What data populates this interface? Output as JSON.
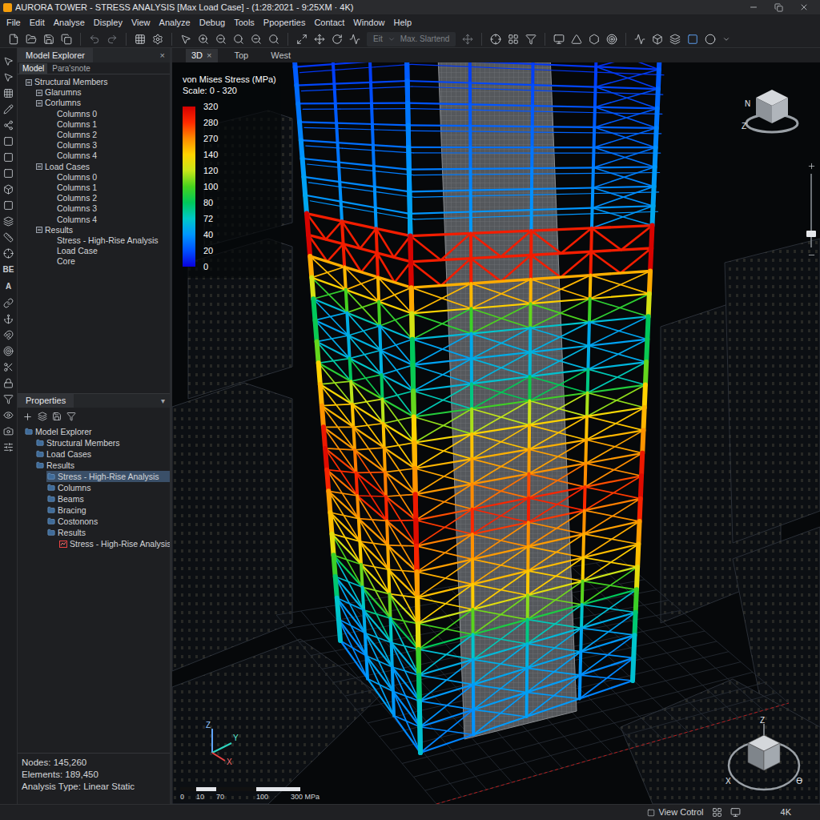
{
  "window": {
    "title": "AURORA TOWER - STRESS ANALYSIS [Max Load Case] - (1:28:2021 - 9:25XM · 4K)"
  },
  "menu": [
    "File",
    "Edit",
    "Analyse",
    "Displey",
    "View",
    "Analyze",
    "Debug",
    "Tools",
    "Ppoperties",
    "Contact",
    "Window",
    "Help"
  ],
  "toolbar": {
    "fields": [
      {
        "label": "Eit",
        "disabled": true
      },
      {
        "label": "Max. Slartend",
        "disabled": true
      }
    ]
  },
  "tool_strip": {
    "glyphs": [
      "BE",
      "A"
    ]
  },
  "model_explorer": {
    "title": "Model Explorer",
    "close": "×",
    "tabs": [
      {
        "label": "Model",
        "selected": true
      },
      {
        "label": "Para'snote",
        "selected": false
      }
    ],
    "tree": [
      {
        "label": "Structural Members",
        "depth": 0,
        "kind": "folder",
        "expanded": true,
        "selected": false
      },
      {
        "label": "Glarumns",
        "depth": 1,
        "kind": "folder",
        "expanded": true,
        "selected": false
      },
      {
        "label": "Corlumns",
        "depth": 1,
        "kind": "folder",
        "expanded": true,
        "selected": false
      },
      {
        "label": "Columns 0",
        "depth": 2,
        "kind": "leaf",
        "expanded": false,
        "selected": false
      },
      {
        "label": "Columns 1",
        "depth": 2,
        "kind": "leaf",
        "expanded": false,
        "selected": false
      },
      {
        "label": "Columns 2",
        "depth": 2,
        "kind": "leaf",
        "expanded": false,
        "selected": false
      },
      {
        "label": "Columns 3",
        "depth": 2,
        "kind": "leaf",
        "expanded": false,
        "selected": false
      },
      {
        "label": "Columns 4",
        "depth": 2,
        "kind": "leaf",
        "expanded": false,
        "selected": false
      },
      {
        "label": "Load Cases",
        "depth": 1,
        "kind": "folder",
        "expanded": true,
        "selected": false
      },
      {
        "label": "Columns 0",
        "depth": 2,
        "kind": "leaf",
        "expanded": false,
        "selected": false
      },
      {
        "label": "Columns 1",
        "depth": 2,
        "kind": "leaf",
        "expanded": false,
        "selected": false
      },
      {
        "label": "Columns 2",
        "depth": 2,
        "kind": "leaf",
        "expanded": false,
        "selected": false
      },
      {
        "label": "Columns 3",
        "depth": 2,
        "kind": "leaf",
        "expanded": false,
        "selected": false
      },
      {
        "label": "Columns 4",
        "depth": 2,
        "kind": "leaf",
        "expanded": false,
        "selected": false
      },
      {
        "label": "Results",
        "depth": 1,
        "kind": "folder",
        "expanded": true,
        "selected": false
      },
      {
        "label": "Stress - High-Rise Analysis",
        "depth": 2,
        "kind": "leaf",
        "expanded": false,
        "selected": false
      },
      {
        "label": "Load Case",
        "depth": 2,
        "kind": "leaf",
        "expanded": false,
        "selected": false
      },
      {
        "label": "Core",
        "depth": 2,
        "kind": "leaf",
        "expanded": false,
        "selected": false
      }
    ]
  },
  "properties": {
    "title": "Properties",
    "menu": "▾",
    "tree": [
      {
        "label": "Model Explorer",
        "depth": 0,
        "kind": "folder",
        "selected": false
      },
      {
        "label": "Structural Members",
        "depth": 1,
        "kind": "folder",
        "selected": false
      },
      {
        "label": "Load Cases",
        "depth": 1,
        "kind": "folder",
        "selected": false
      },
      {
        "label": "Results",
        "depth": 1,
        "kind": "folder",
        "selected": false
      },
      {
        "label": "Stress - High-Rise Analysis",
        "depth": 2,
        "kind": "leaf",
        "selected": true
      },
      {
        "label": "Columns",
        "depth": 2,
        "kind": "folder",
        "selected": false
      },
      {
        "label": "Beams",
        "depth": 2,
        "kind": "folder",
        "selected": false
      },
      {
        "label": "Bracing",
        "depth": 2,
        "kind": "folder",
        "selected": false
      },
      {
        "label": "Costonons",
        "depth": 2,
        "kind": "folder",
        "selected": false
      },
      {
        "label": "Results",
        "depth": 2,
        "kind": "folder",
        "selected": false
      },
      {
        "label": "Stress - High-Rise Analysis",
        "depth": 3,
        "kind": "result",
        "selected": false
      }
    ]
  },
  "stats": [
    "Nodes: 145,260",
    "Elements: 189,450",
    "Analysis Type: Linear Static"
  ],
  "viewport": {
    "tabs": [
      {
        "label": "3D",
        "selected": true,
        "close": "×"
      },
      {
        "label": "Top",
        "selected": false,
        "close": ""
      },
      {
        "label": "West",
        "selected": false,
        "close": ""
      }
    ]
  },
  "legend": {
    "title": "von Mises Stress (MPa)",
    "scale": "Scale: 0 - 320",
    "items": [
      {
        "value": "320",
        "color": "#d40000"
      },
      {
        "value": "280",
        "color": "#ff2a00"
      },
      {
        "value": "270",
        "color": "#ff8a00"
      },
      {
        "value": "140",
        "color": "#ffd400"
      },
      {
        "value": "120",
        "color": "#c8e619"
      },
      {
        "value": "100",
        "color": "#46d21e"
      },
      {
        "value": "80",
        "color": "#00c85a"
      },
      {
        "value": "72",
        "color": "#00c8c8"
      },
      {
        "value": "40",
        "color": "#0096ff"
      },
      {
        "value": "20",
        "color": "#0050ff"
      },
      {
        "value": "0",
        "color": "#0a00dc"
      }
    ]
  },
  "ruler": [
    "0",
    "10",
    "70",
    "100",
    "300 MPa"
  ],
  "view_cube": {
    "north": "N",
    "axis": "Z"
  },
  "axes": {
    "z": "Z",
    "y": "Y",
    "x": "X"
  },
  "nav_cube": {
    "top": "Z",
    "left": "X",
    "right": "ϴ"
  },
  "zoom": {
    "level": 0.23
  },
  "status_bar": {
    "view_control": "View Cotrol",
    "resolution": "4K"
  }
}
